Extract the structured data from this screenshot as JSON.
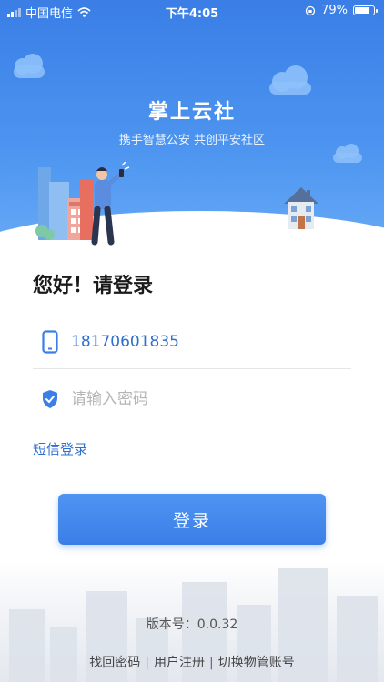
{
  "status_bar": {
    "carrier": "中国电信",
    "time": "下午4:05",
    "battery_percent": "79%",
    "battery_level": 0.79,
    "icons": [
      "signal-icon",
      "wifi-icon",
      "orientation-lock-icon",
      "battery-icon"
    ]
  },
  "header": {
    "title": "掌上云社",
    "slogan": "携手智慧公安 共创平安社区"
  },
  "login": {
    "greeting": "您好！请登录",
    "phone_value": "18170601835",
    "password_placeholder": "请输入密码",
    "sms_login_label": "短信登录",
    "submit_label": "登录"
  },
  "footer": {
    "version": "版本号：0.0.32",
    "links": [
      "找回密码",
      "用户注册",
      "切换物管账号"
    ],
    "separator": "|"
  },
  "colors": {
    "accent": "#3b7ee8",
    "link": "#2f6fd0",
    "hero_top": "#3a7ee6",
    "hero_bottom": "#67a9f6"
  }
}
